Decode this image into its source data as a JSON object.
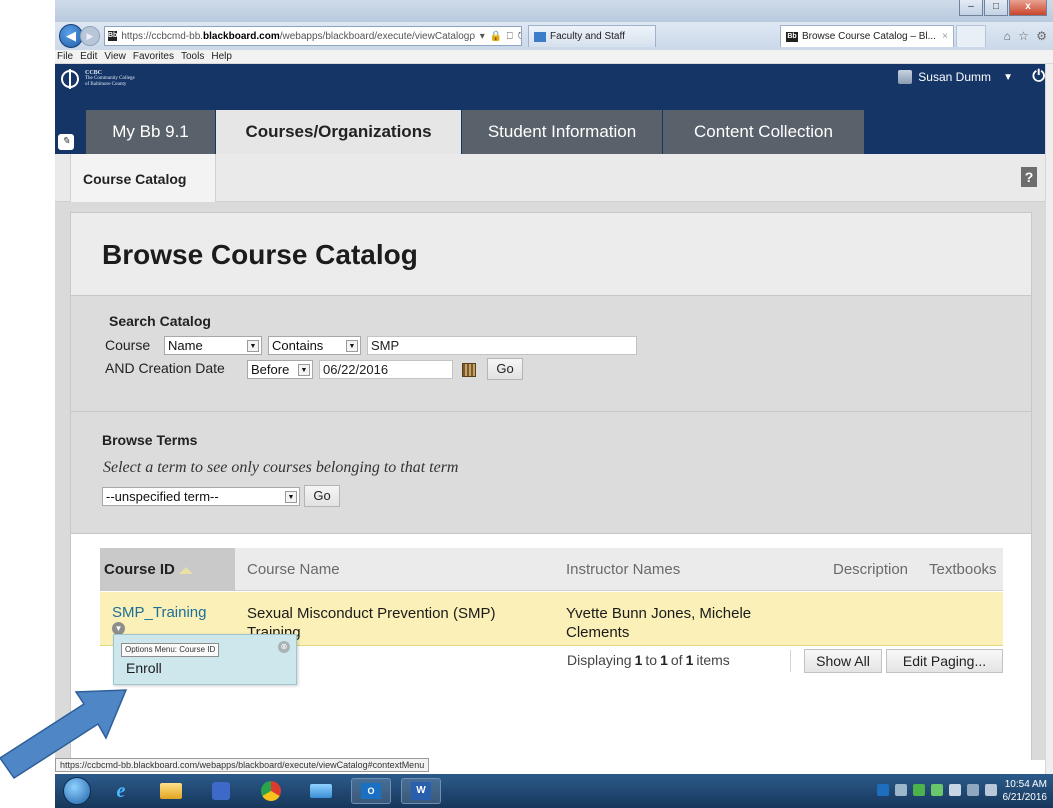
{
  "browser": {
    "url_prefix": "https://ccbcmd-bb.",
    "url_domain": "blackboard.com",
    "url_path": "/webapps/blackboard/execute/viewCatalog",
    "url_icons": "ρ ▾ 🔒 ⎕ ↻ ✕",
    "tabs": [
      {
        "label": "Faculty and Staff",
        "active": false
      },
      {
        "label": "Browse Course Catalog – Bl...",
        "active": true
      }
    ],
    "tab_close": "×",
    "menu": [
      "File",
      "Edit",
      "View",
      "Favorites",
      "Tools",
      "Help"
    ],
    "window_buttons": [
      "–",
      "□",
      "x"
    ],
    "status_url": "https://ccbcmd-bb.blackboard.com/webapps/blackboard/execute/viewCatalog#contextMenu"
  },
  "header": {
    "logo_lines": [
      "CCBC",
      "The Community College",
      "of Baltimore County"
    ],
    "user_name": "Susan Dumm",
    "user_menu_icon": "▼",
    "power_icon": "⏻"
  },
  "tabs": [
    {
      "label": "My Bb 9.1"
    },
    {
      "label": "Courses/Organizations"
    },
    {
      "label": "Student Information"
    },
    {
      "label": "Content Collection"
    }
  ],
  "subnav": {
    "breadcrumb": "Course Catalog",
    "help": "?"
  },
  "page": {
    "title": "Browse Course Catalog"
  },
  "search": {
    "heading": "Search Catalog",
    "course_label": "Course",
    "field_select": "Name",
    "operator_select": "Contains",
    "course_value": "SMP",
    "date_label": "AND Creation Date",
    "date_op_select": "Before",
    "date_value": "06/22/2016",
    "go_label": "Go"
  },
  "terms": {
    "heading": "Browse Terms",
    "hint": "Select a term to see only courses belonging to that term",
    "term_select": "--unspecified term--",
    "go_label": "Go"
  },
  "table": {
    "columns": [
      "Course ID",
      "Course Name",
      "Instructor Names",
      "Description",
      "Textbooks"
    ],
    "rows": [
      {
        "course_id": "SMP_Training",
        "course_name": "Sexual Misconduct Prevention (SMP) Training",
        "instructors": "Yvette Bunn Jones, Michele Clements"
      }
    ]
  },
  "paging": {
    "prefix": "Displaying",
    "from": "1",
    "to_word": "to",
    "to": "1",
    "of_word": "of",
    "total": "1",
    "suffix": "items",
    "show_all": "Show All",
    "edit_paging": "Edit Paging..."
  },
  "context_menu": {
    "tooltip": "Options Menu: Course ID",
    "item": "Enroll",
    "close": "⊗"
  },
  "taskbar": {
    "word_icon": "W",
    "outlook_icon": "O",
    "clock_time": "10:54 AM",
    "clock_date": "6/21/2016"
  }
}
